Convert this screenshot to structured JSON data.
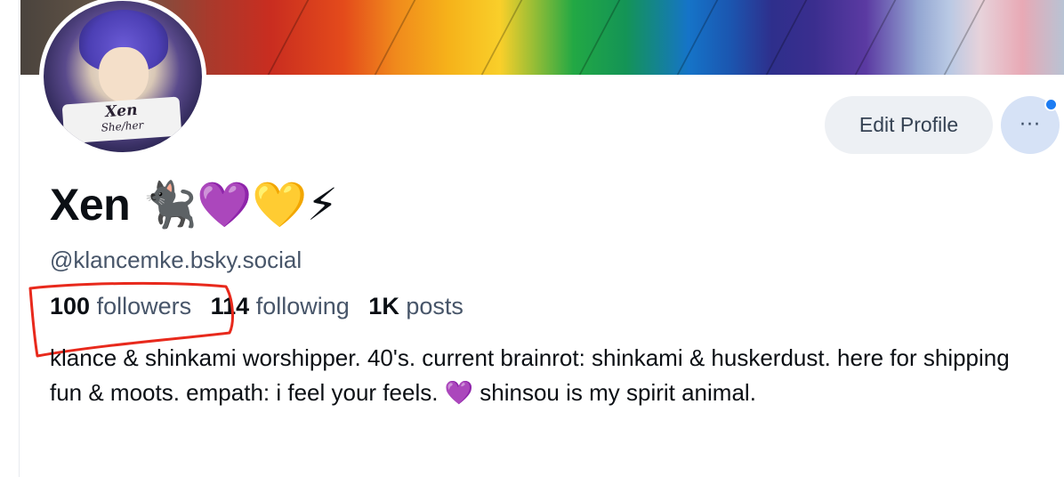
{
  "profile": {
    "display_name": "Xen 🐈‍⬛💜💛⚡",
    "handle": "@klancemke.bsky.social",
    "avatar": {
      "name_text": "Xen",
      "pronoun_text": "She/her"
    },
    "stats": [
      {
        "count": "100",
        "label": "followers"
      },
      {
        "count": "114",
        "label": "following"
      },
      {
        "count": "1K",
        "label": "posts"
      }
    ],
    "bio": "klance & shinkami worshipper. 40's. current brainrot: shinkami & huskerdust. here for shipping fun & moots. empath: i feel your feels. 💜 shinsou is my spirit animal."
  },
  "actions": {
    "edit_profile_label": "Edit Profile",
    "more_label": "···"
  },
  "annotation": {
    "color": "#e8291c"
  },
  "colors": {
    "notification_dot": "#1d7cf2",
    "more_button_bg": "#d6e2f6",
    "edit_button_bg": "#edf0f4"
  }
}
